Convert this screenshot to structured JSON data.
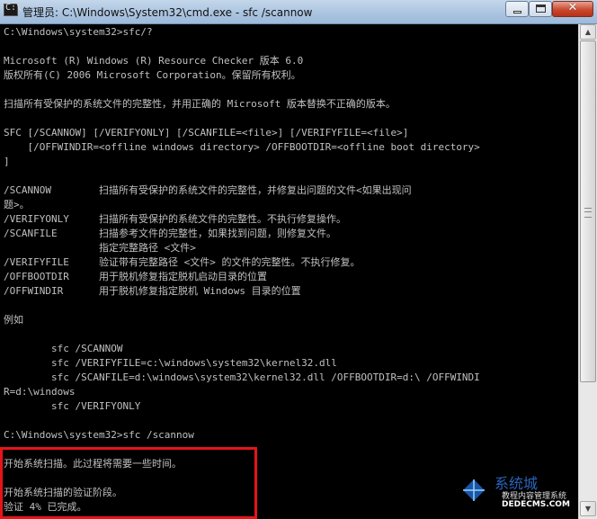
{
  "window": {
    "title": "管理员: C:\\Windows\\System32\\cmd.exe - sfc  /scannow",
    "minimize_icon": "minimize-icon",
    "maximize_icon": "maximize-icon",
    "close_icon": "close-icon"
  },
  "console": {
    "lines": [
      "C:\\Windows\\system32>sfc/?",
      "",
      "Microsoft (R) Windows (R) Resource Checker 版本 6.0",
      "版权所有(C) 2006 Microsoft Corporation。保留所有权利。",
      "",
      "扫描所有受保护的系统文件的完整性，并用正确的 Microsoft 版本替换不正确的版本。",
      "",
      "SFC [/SCANNOW] [/VERIFYONLY] [/SCANFILE=<file>] [/VERIFYFILE=<file>]",
      "    [/OFFWINDIR=<offline windows directory> /OFFBOOTDIR=<offline boot directory>",
      "]",
      "",
      "/SCANNOW        扫描所有受保护的系统文件的完整性，并修复出问题的文件<如果出现问",
      "题>。",
      "/VERIFYONLY     扫描所有受保护的系统文件的完整性。不执行修复操作。",
      "/SCANFILE       扫描参考文件的完整性，如果找到问题，则修复文件。",
      "                指定完整路径 <文件>",
      "/VERIFYFILE     验证带有完整路径 <文件> 的文件的完整性。不执行修复。",
      "/OFFBOOTDIR     用于脱机修复指定脱机启动目录的位置",
      "/OFFWINDIR      用于脱机修复指定脱机 Windows 目录的位置",
      "",
      "例如",
      "",
      "        sfc /SCANNOW",
      "        sfc /VERIFYFILE=c:\\windows\\system32\\kernel32.dll",
      "        sfc /SCANFILE=d:\\windows\\system32\\kernel32.dll /OFFBOOTDIR=d:\\ /OFFWINDI",
      "R=d:\\windows",
      "        sfc /VERIFYONLY",
      "",
      "C:\\Windows\\system32>sfc /scannow",
      "",
      "开始系统扫描。此过程将需要一些时间。",
      "",
      "开始系统扫描的验证阶段。",
      "验证 4% 已完成。"
    ]
  },
  "watermark": {
    "brand": "系统城",
    "tagline": "教程内容管理系统",
    "url": "DEDECMS.COM",
    "logo_icon": "windows-logo-icon"
  }
}
